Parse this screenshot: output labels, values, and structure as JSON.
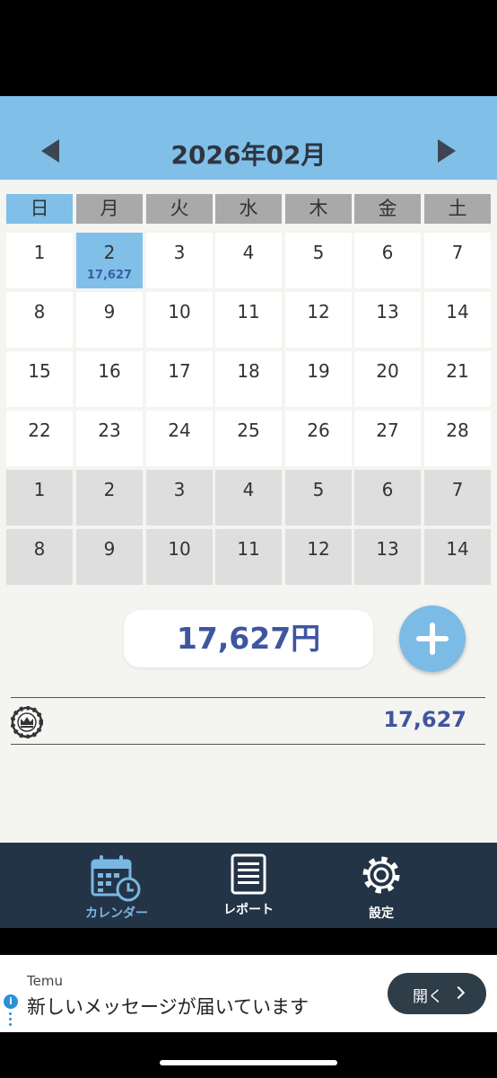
{
  "header": {
    "month_title": "2026年02月"
  },
  "weekdays": [
    "日",
    "月",
    "火",
    "水",
    "木",
    "金",
    "土"
  ],
  "weeks": [
    [
      {
        "d": "1"
      },
      {
        "d": "2",
        "amt": "17,627",
        "sel": true
      },
      {
        "d": "3"
      },
      {
        "d": "4"
      },
      {
        "d": "5"
      },
      {
        "d": "6"
      },
      {
        "d": "7"
      }
    ],
    [
      {
        "d": "8"
      },
      {
        "d": "9"
      },
      {
        "d": "10"
      },
      {
        "d": "11"
      },
      {
        "d": "12"
      },
      {
        "d": "13"
      },
      {
        "d": "14"
      }
    ],
    [
      {
        "d": "15"
      },
      {
        "d": "16"
      },
      {
        "d": "17"
      },
      {
        "d": "18"
      },
      {
        "d": "19"
      },
      {
        "d": "20"
      },
      {
        "d": "21"
      }
    ],
    [
      {
        "d": "22"
      },
      {
        "d": "23"
      },
      {
        "d": "24"
      },
      {
        "d": "25"
      },
      {
        "d": "26"
      },
      {
        "d": "27"
      },
      {
        "d": "28"
      }
    ],
    [
      {
        "d": "1",
        "next": true
      },
      {
        "d": "2",
        "next": true
      },
      {
        "d": "3",
        "next": true
      },
      {
        "d": "4",
        "next": true
      },
      {
        "d": "5",
        "next": true
      },
      {
        "d": "6",
        "next": true
      },
      {
        "d": "7",
        "next": true
      }
    ],
    [
      {
        "d": "8",
        "next": true
      },
      {
        "d": "9",
        "next": true
      },
      {
        "d": "10",
        "next": true
      },
      {
        "d": "11",
        "next": true
      },
      {
        "d": "12",
        "next": true
      },
      {
        "d": "13",
        "next": true
      },
      {
        "d": "14",
        "next": true
      }
    ]
  ],
  "summary": {
    "total": "17,627円"
  },
  "entries": [
    {
      "icon": "crown-chip-icon",
      "amount": "17,627"
    }
  ],
  "tabs": {
    "calendar": "カレンダー",
    "report": "レポート",
    "settings": "設定"
  },
  "ad": {
    "brand": "Temu",
    "message": "新しいメッセージが届いています",
    "open_label": "開く"
  },
  "colors": {
    "accent": "#80bfe8",
    "amount": "#3f55a0",
    "tabbar": "#243447"
  }
}
